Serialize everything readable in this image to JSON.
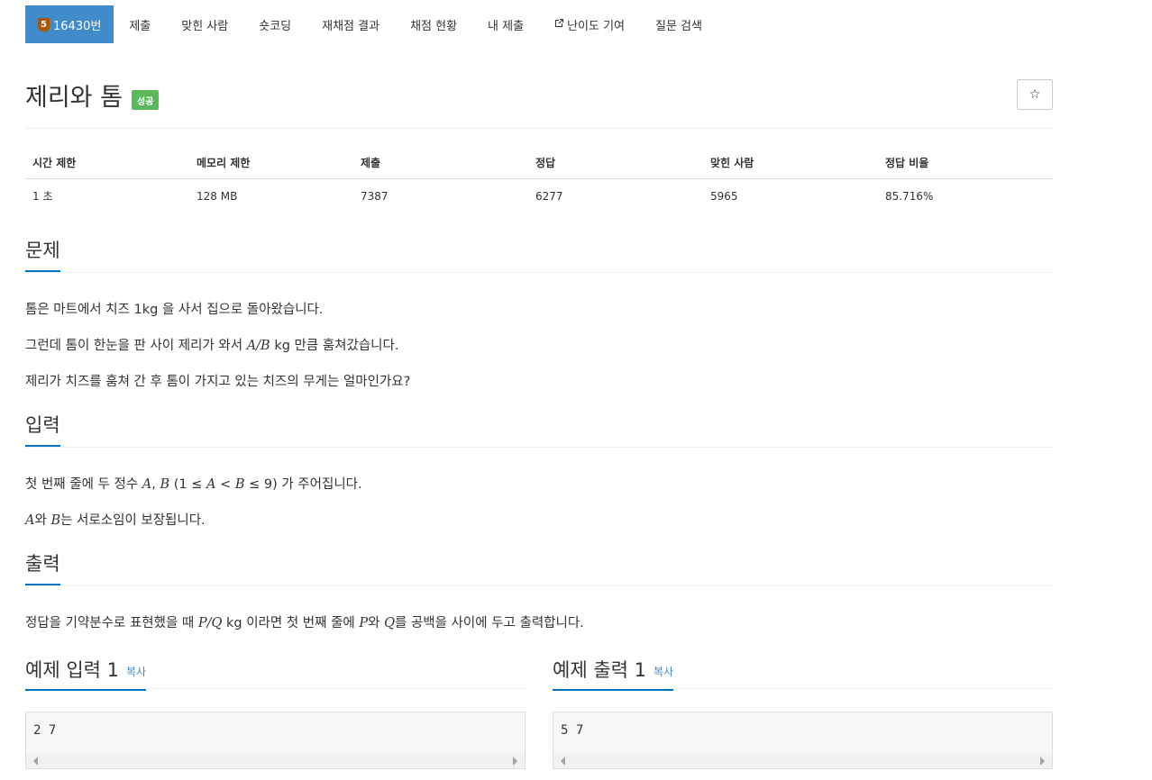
{
  "nav": {
    "problem_tier": "5",
    "problem_number": "16430번",
    "items": [
      "제출",
      "맞힌 사람",
      "숏코딩",
      "재채점 결과",
      "채점 현황",
      "내 제출",
      "난이도 기여",
      "질문 검색"
    ]
  },
  "problem": {
    "title": "제리와 톰",
    "badge": "성공",
    "star": "☆"
  },
  "info": {
    "headers": [
      "시간 제한",
      "메모리 제한",
      "제출",
      "정답",
      "맞힌 사람",
      "정답 비율"
    ],
    "values": [
      "1 초",
      "128 MB",
      "7387",
      "6277",
      "5965",
      "85.716%"
    ]
  },
  "sections": {
    "desc_title": "문제",
    "desc": [
      "톰은 마트에서 치즈 1kg 을 사서 집으로 돌아왔습니다.",
      [
        "그런데 톰이 한눈을 판 사이 제리가 와서 ",
        "A/B",
        " kg 만큼 훔쳐갔습니다."
      ],
      "제리가 치즈를 훔쳐 간 후 톰이 가지고 있는 치즈의 무게는 얼마인가요?"
    ],
    "input_title": "입력",
    "input": [
      [
        "첫 번째 줄에 두 정수 ",
        "A",
        ", ",
        "B",
        " (1 ≤ ",
        "A",
        " < ",
        "B",
        " ≤ 9) 가 주어집니다."
      ],
      [
        "A",
        "와 ",
        "B",
        "는 서로소임이 보장됩니다."
      ]
    ],
    "output_title": "출력",
    "output": [
      [
        "정답을 기약분수로 표현했을 때 ",
        "P/Q",
        " kg 이라면 첫 번째 줄에 ",
        "P",
        "와 ",
        "Q",
        "를 공백을 사이에 두고 출력합니다."
      ]
    ]
  },
  "examples": {
    "input_title": "예제 입력 1",
    "output_title": "예제 출력 1",
    "copy_label": "복사",
    "input_value": "2 7",
    "output_value": "5 7"
  },
  "colors": {
    "accent": "#428bca",
    "success": "#5cb85c",
    "underline": "#0076c0",
    "tier_bronze": "#ad5600"
  }
}
